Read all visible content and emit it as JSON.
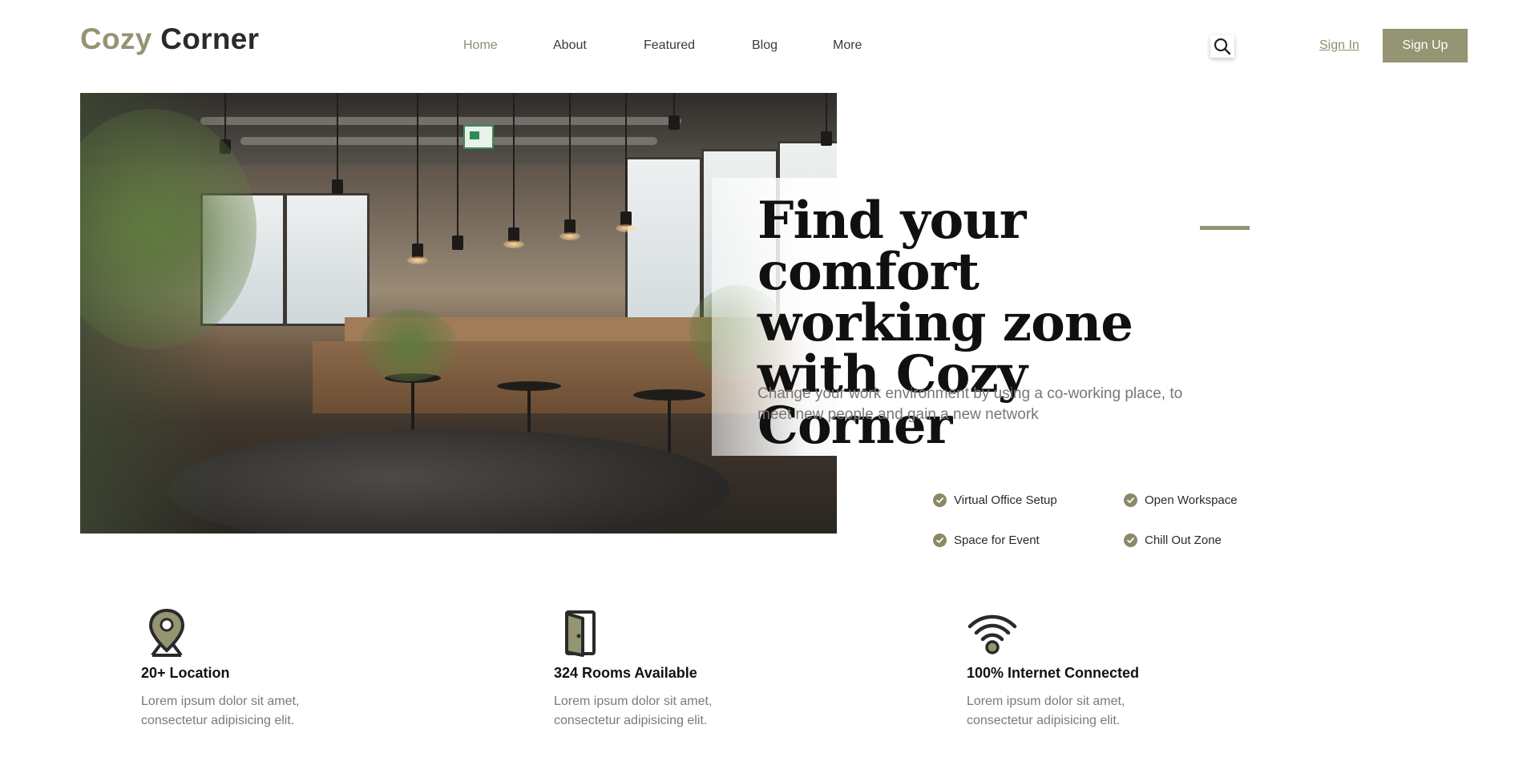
{
  "brand": {
    "first": "Cozy",
    "second": "Corner",
    "accent_color": "#959473"
  },
  "nav": {
    "items": [
      {
        "label": "Home",
        "active": true
      },
      {
        "label": "About",
        "active": false
      },
      {
        "label": "Featured",
        "active": false
      },
      {
        "label": "Blog",
        "active": false
      },
      {
        "label": "More",
        "active": false
      }
    ]
  },
  "header": {
    "search_icon": "search-icon",
    "signin_label": "Sign In",
    "signup_label": "Sign Up"
  },
  "hero": {
    "headline": "Find your comfort working zone with Cozy Corner",
    "subtext": "Change your work environment by using a co-working place, to meet new people and gain a new network"
  },
  "features": [
    {
      "label": "Virtual Office Setup",
      "icon": "check-circle-icon"
    },
    {
      "label": "Open Workspace",
      "icon": "check-circle-icon"
    },
    {
      "label": "Space for Event",
      "icon": "check-circle-icon"
    },
    {
      "label": "Chill Out Zone",
      "icon": "check-circle-icon"
    }
  ],
  "stats": [
    {
      "title": "20+ Location",
      "desc": "Lorem ipsum dolor sit amet, consectetur adipisicing elit.",
      "icon": "location-pin-icon"
    },
    {
      "title": "324 Rooms Available",
      "desc": "Lorem ipsum dolor sit amet, consectetur adipisicing elit.",
      "icon": "door-icon"
    },
    {
      "title": "100% Internet Connected",
      "desc": "Lorem ipsum dolor sit amet, consectetur adipisicing elit.",
      "icon": "wifi-icon"
    }
  ]
}
